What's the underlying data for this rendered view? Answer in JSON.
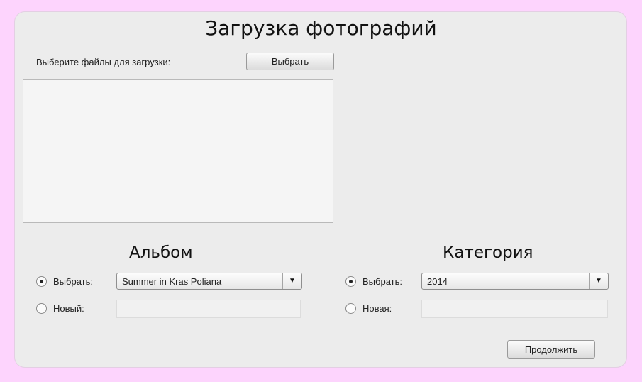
{
  "page": {
    "title": "Загрузка фотографий"
  },
  "upload": {
    "prompt_label": "Выберите файлы для загрузки:",
    "choose_button": "Выбрать"
  },
  "album": {
    "title": "Альбом",
    "select_option_label": "Выбрать:",
    "new_option_label": "Новый:",
    "selected_value": "Summer in Kras Poliana",
    "new_value": "",
    "selected_radio": "select"
  },
  "category": {
    "title": "Категория",
    "select_option_label": "Выбрать:",
    "new_option_label": "Новая:",
    "selected_value": "2014",
    "new_value": "",
    "selected_radio": "select"
  },
  "footer": {
    "continue_button": "Продолжить"
  }
}
